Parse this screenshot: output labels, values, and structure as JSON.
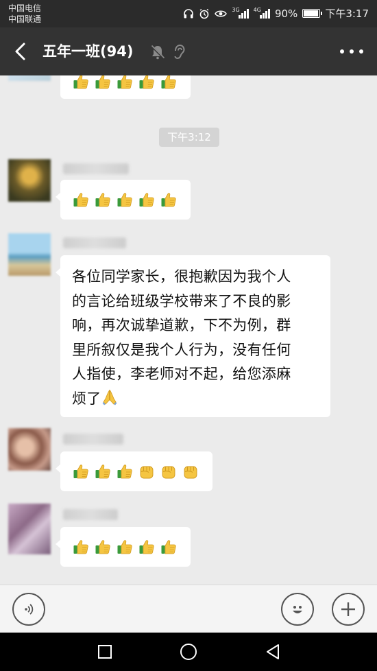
{
  "status_bar": {
    "carrier_1": "中国电信",
    "carrier_2": "中国联通",
    "network_1": "3G",
    "network_2": "4G",
    "battery": "90%",
    "time": "下午3:17"
  },
  "header": {
    "title": "五年一班(94)",
    "icons": [
      "back-arrow-icon",
      "mute-bell-icon",
      "earpiece-icon",
      "more-icon"
    ]
  },
  "chat": {
    "timestamp": "下午3:12",
    "messages": [
      {
        "type": "emoji",
        "emojis": [
          "thumbs-up",
          "thumbs-up",
          "thumbs-up",
          "thumbs-up",
          "thumbs-up"
        ]
      },
      {
        "type": "emoji",
        "emojis": [
          "thumbs-up",
          "thumbs-up",
          "thumbs-up",
          "thumbs-up",
          "thumbs-up"
        ]
      },
      {
        "type": "text",
        "lines": [
          "各位同学家长，很抱歉因为我个人",
          "的言论给班级学校带来了不良的影",
          "响，再次诚挚道歉，下不为例，群",
          "里所叙仅是我个人行为，没有任何",
          "人指使，李老师对不起，给您添麻",
          "烦了"
        ],
        "trailing_emoji": "folded-hands"
      },
      {
        "type": "emoji",
        "emojis": [
          "thumbs-up",
          "thumbs-up",
          "thumbs-up",
          "raised-fist",
          "raised-fist",
          "raised-fist"
        ]
      },
      {
        "type": "emoji",
        "emojis": [
          "thumbs-up",
          "thumbs-up",
          "thumbs-up",
          "thumbs-up",
          "thumbs-up"
        ]
      }
    ]
  },
  "input_bar": {
    "icons": [
      "voice-icon",
      "emoji-face-icon",
      "plus-icon"
    ]
  },
  "nav_bar": {
    "icons": [
      "recent-apps-icon",
      "home-icon",
      "back-triangle-icon"
    ]
  },
  "colors": {
    "status_bar": "#2b2b2b",
    "title_bar": "#333333",
    "chat_background": "#ebebeb",
    "bubble": "#ffffff",
    "thumbs_up": "#f5c542"
  }
}
